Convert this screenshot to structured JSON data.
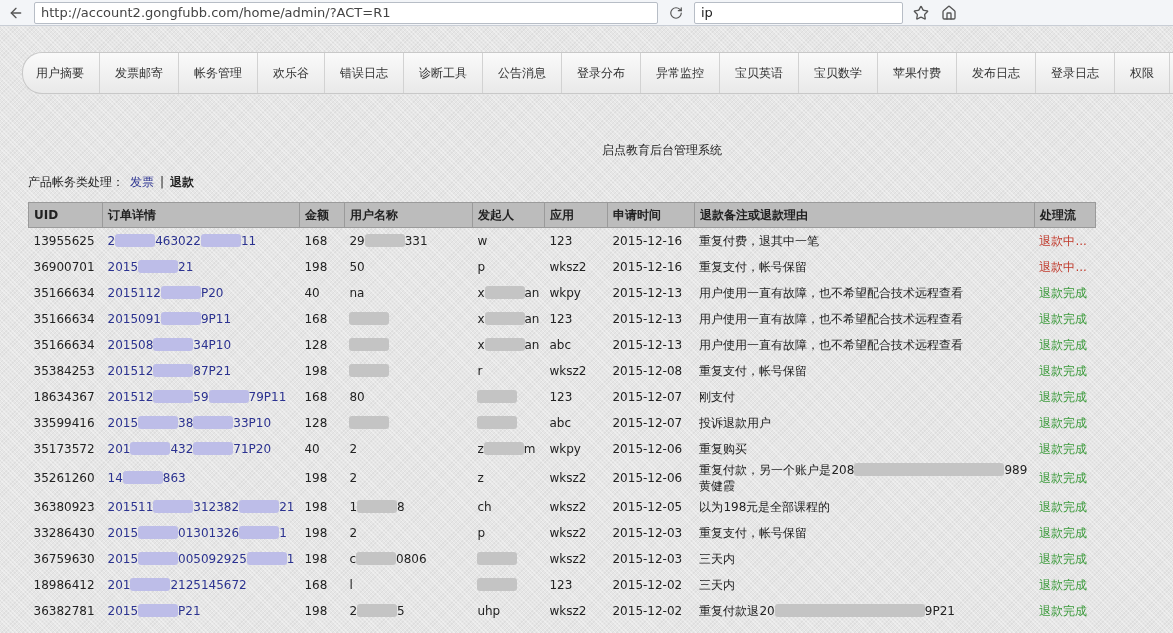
{
  "browser": {
    "url": "http://account2.gongfubb.com/home/admin/?ACT=R1",
    "search": "ip"
  },
  "nav_tabs": [
    "用户摘要",
    "发票邮寄",
    "帐务管理",
    "欢乐谷",
    "错误日志",
    "诊断工具",
    "公告消息",
    "登录分布",
    "异常监控",
    "宝贝英语",
    "宝贝数学",
    "苹果付费",
    "发布日志",
    "登录日志",
    "权限"
  ],
  "page_title": "启点教育后台管理系统",
  "breadcrumb": {
    "label": "产品帐务类处理：",
    "link": "发票",
    "separator": "|",
    "current": "退款"
  },
  "table": {
    "columns": [
      "UID",
      "订单详情",
      "金额",
      "用户名称",
      "发起人",
      "应用",
      "申请时间",
      "退款备注或退款理由",
      "处理流"
    ],
    "rows": [
      {
        "uid": "13955625",
        "order": [
          "2",
          "463022",
          "11"
        ],
        "amount": "168",
        "user": [
          "29",
          "331"
        ],
        "initiator": [
          "w"
        ],
        "app": "123",
        "date": "2015-12-16",
        "reason": [
          "重复付费，退其中一笔"
        ],
        "status": "退款中...",
        "kind": "pending"
      },
      {
        "uid": "36900701",
        "order": [
          "2015",
          "21"
        ],
        "amount": "198",
        "user": [
          "50"
        ],
        "initiator": [
          "p"
        ],
        "app": "wksz2",
        "date": "2015-12-16",
        "reason": [
          "重复支付，帐号保留"
        ],
        "status": "退款中...",
        "kind": "pending"
      },
      {
        "uid": "35166634",
        "order": [
          "2015112",
          "P20"
        ],
        "amount": "40",
        "user": [
          "na"
        ],
        "initiator": [
          "x",
          "an"
        ],
        "app": "wkpy",
        "date": "2015-12-13",
        "reason": [
          "用户使用一直有故障，也不希望配合技术远程查看"
        ],
        "status": "退款完成",
        "kind": "done"
      },
      {
        "uid": "35166634",
        "order": [
          "2015091",
          "9P11"
        ],
        "amount": "168",
        "initiator": [
          "x",
          "an"
        ],
        "app": "123",
        "date": "2015-12-13",
        "reason": [
          "用户使用一直有故障，也不希望配合技术远程查看"
        ],
        "status": "退款完成",
        "kind": "done"
      },
      {
        "uid": "35166634",
        "order": [
          "201508",
          "34P10"
        ],
        "amount": "128",
        "initiator": [
          "x",
          "an"
        ],
        "app": "abc",
        "date": "2015-12-13",
        "reason": [
          "用户使用一直有故障，也不希望配合技术远程查看"
        ],
        "status": "退款完成",
        "kind": "done"
      },
      {
        "uid": "35384253",
        "order": [
          "201512",
          "87P21"
        ],
        "amount": "198",
        "initiator": [
          "r"
        ],
        "app": "wksz2",
        "date": "2015-12-08",
        "reason": [
          "重复支付，帐号保留"
        ],
        "status": "退款完成",
        "kind": "done"
      },
      {
        "uid": "18634367",
        "order": [
          "201512",
          "59",
          "79P11"
        ],
        "amount": "168",
        "user": [
          "80"
        ],
        "app": "123",
        "date": "2015-12-07",
        "reason": [
          "刚支付"
        ],
        "status": "退款完成",
        "kind": "done"
      },
      {
        "uid": "33599416",
        "order": [
          "2015",
          "38",
          "33P10"
        ],
        "amount": "128",
        "app": "abc",
        "date": "2015-12-07",
        "reason": [
          "投诉退款用户"
        ],
        "status": "退款完成",
        "kind": "done"
      },
      {
        "uid": "35173572",
        "order": [
          "201",
          "432",
          "71P20"
        ],
        "amount": "40",
        "user": [
          "2"
        ],
        "initiator": [
          "z",
          "m"
        ],
        "app": "wkpy",
        "date": "2015-12-06",
        "reason": [
          "重复购买"
        ],
        "status": "退款完成",
        "kind": "done"
      },
      {
        "uid": "35261260",
        "order": [
          "14",
          "863"
        ],
        "amount": "198",
        "user": [
          "2"
        ],
        "initiator": [
          "z"
        ],
        "app": "wksz2",
        "date": "2015-12-06",
        "reason": [
          "重复付款，另一个账户是208",
          "989"
        ],
        "reason_line2": "黄健霞",
        "status": "退款完成",
        "kind": "done"
      },
      {
        "uid": "36380923",
        "order": [
          "201511",
          "312382",
          "21"
        ],
        "amount": "198",
        "user": [
          "1",
          "8"
        ],
        "initiator": [
          "ch"
        ],
        "app": "wksz2",
        "date": "2015-12-05",
        "reason": [
          "以为198元是全部课程的"
        ],
        "status": "退款完成",
        "kind": "done"
      },
      {
        "uid": "33286430",
        "order": [
          "2015",
          "01301326",
          "1"
        ],
        "amount": "198",
        "user": [
          "2"
        ],
        "initiator": [
          "p"
        ],
        "app": "wksz2",
        "date": "2015-12-03",
        "reason": [
          "重复支付，帐号保留"
        ],
        "status": "退款完成",
        "kind": "done"
      },
      {
        "uid": "36759630",
        "order": [
          "2015",
          "005092925",
          "1"
        ],
        "amount": "198",
        "user": [
          "c",
          "0806"
        ],
        "app": "wksz2",
        "date": "2015-12-03",
        "reason": [
          "三天内"
        ],
        "status": "退款完成",
        "kind": "done"
      },
      {
        "uid": "18986412",
        "order": [
          "201",
          "2125145672"
        ],
        "amount": "168",
        "user": [
          "l"
        ],
        "app": "123",
        "date": "2015-12-02",
        "reason": [
          "三天内"
        ],
        "status": "退款完成",
        "kind": "done"
      },
      {
        "uid": "36382781",
        "order": [
          "2015",
          "P21"
        ],
        "amount": "198",
        "user": [
          "2",
          "5"
        ],
        "initiator": [
          "uhp"
        ],
        "app": "wksz2",
        "date": "2015-12-02",
        "reason": [
          "重复付款退20",
          "9P21"
        ],
        "status": "退款完成",
        "kind": "done"
      }
    ]
  }
}
